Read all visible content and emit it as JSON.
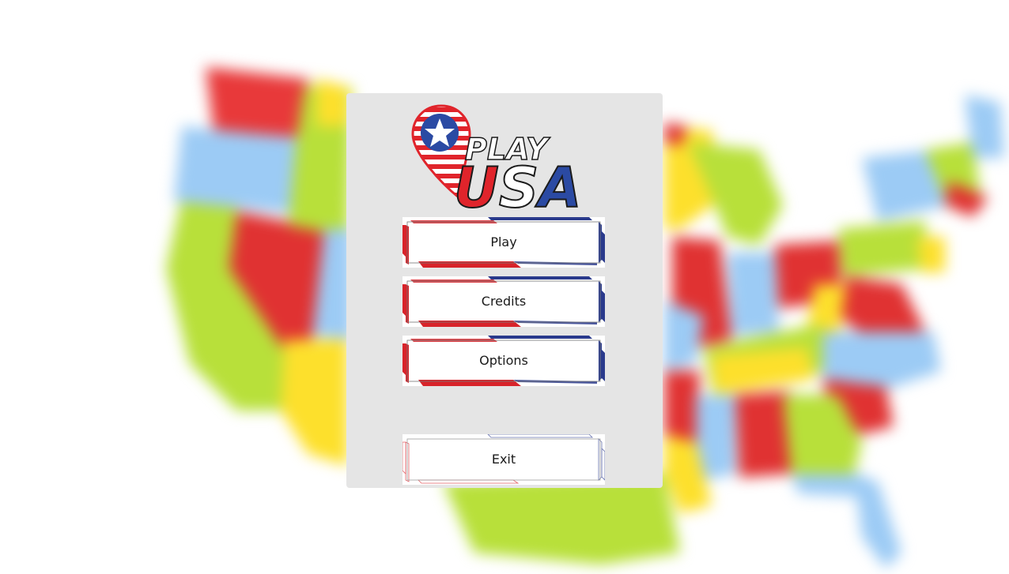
{
  "logo": {
    "line1": "PLAY",
    "line2": "USA",
    "colors": {
      "red": "#e0242b",
      "blue": "#2b4aa3",
      "white": "#ffffff"
    }
  },
  "menu": {
    "play_label": "Play",
    "credits_label": "Credits",
    "options_label": "Options",
    "exit_label": "Exit"
  },
  "theme": {
    "panel_bg": "#e5e5e5",
    "accent_red": "#d8232a",
    "accent_blue": "#2a3a8c"
  }
}
